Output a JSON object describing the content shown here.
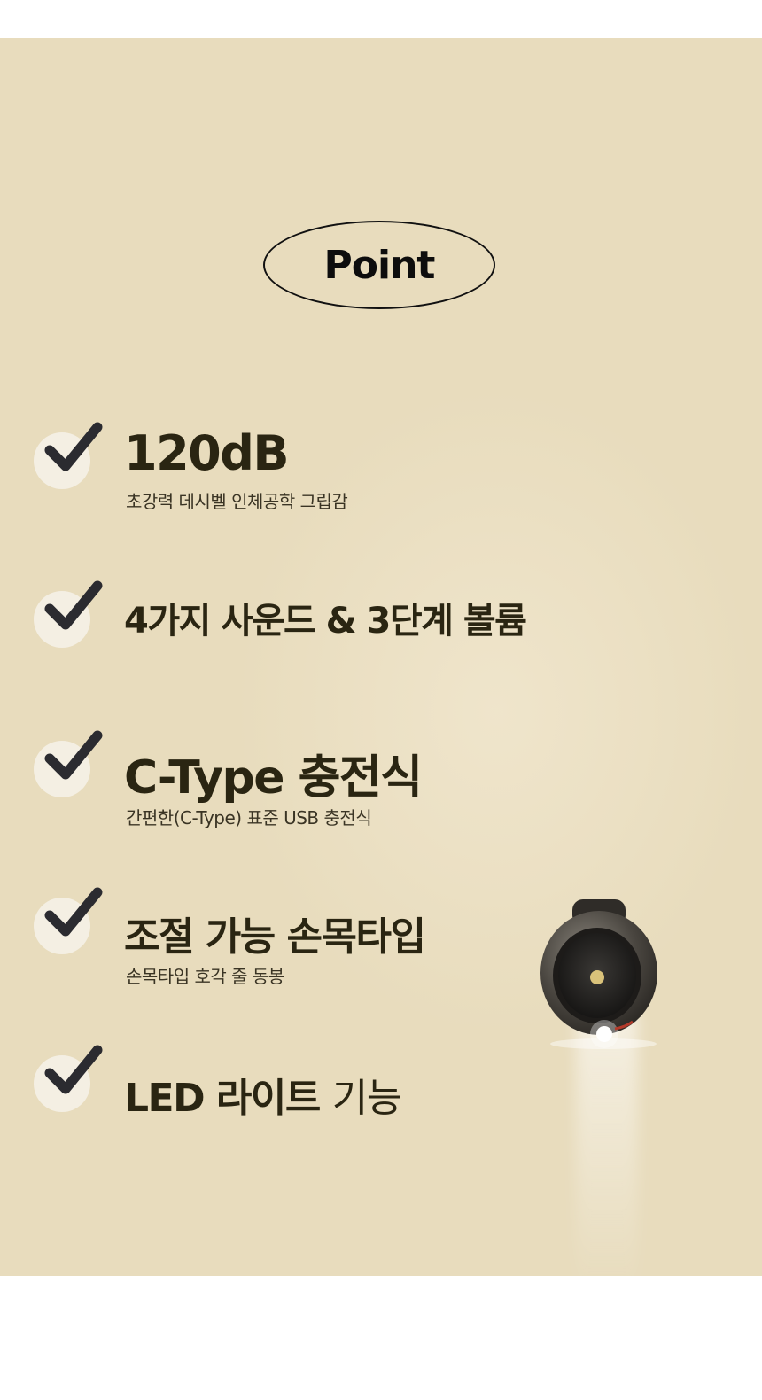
{
  "badge": {
    "label": "Point"
  },
  "features": [
    {
      "title": "120dB",
      "subtitle": "초강력 데시벨 인체공학 그립감"
    },
    {
      "title": "4가지 사운드 & 3단계 볼륨"
    },
    {
      "title": "C-Type 충전식",
      "subtitle": "간편한(C-Type) 표준 USB 충전식"
    },
    {
      "title": "조절 가능 손목타입",
      "subtitle": "손목타입 호각 줄 동봉"
    },
    {
      "title_bold": "LED 라이트",
      "title_light": "기능"
    }
  ],
  "colors": {
    "panel_bg": "#e8dcbd",
    "title_text": "#2a2512",
    "check_mark": "#2b2b30",
    "check_circle": "#f4efe3"
  },
  "icons": {
    "check": "checkmark-icon"
  }
}
